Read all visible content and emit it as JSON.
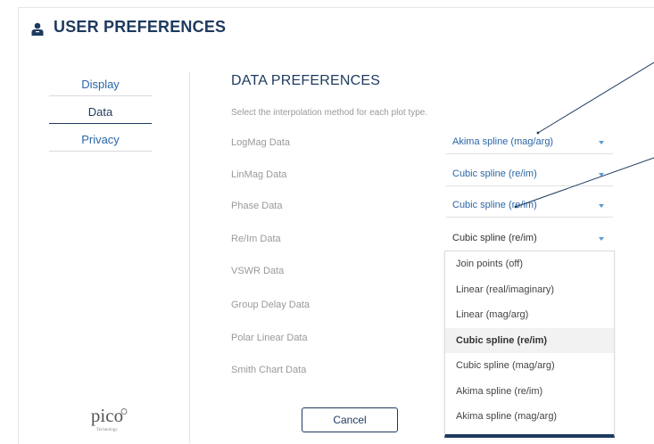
{
  "header": {
    "title": "USER PREFERENCES",
    "icon": "user-icon"
  },
  "sidebar": {
    "items": [
      {
        "label": "Display",
        "active": false
      },
      {
        "label": "Data",
        "active": true
      },
      {
        "label": "Privacy",
        "active": false
      }
    ]
  },
  "main": {
    "section_title": "DATA PREFERENCES",
    "instruction": "Select the interpolation method for each plot type.",
    "rows": [
      {
        "label": "LogMag Data",
        "value": "Akima spline (mag/arg)"
      },
      {
        "label": "LinMag Data",
        "value": "Cubic spline (re/im)"
      },
      {
        "label": "Phase Data",
        "value": "Cubic spline (re/im)"
      },
      {
        "label": "Re/Im Data",
        "value": "Cubic spline (re/im)",
        "open": true
      },
      {
        "label": "VSWR Data"
      },
      {
        "label": "Group Delay Data"
      },
      {
        "label": "Polar Linear Data"
      },
      {
        "label": "Smith Chart Data"
      }
    ],
    "dropdown": {
      "options": [
        "Join points (off)",
        "Linear (real/imaginary)",
        "Linear (mag/arg)",
        "Cubic spline (re/im)",
        "Cubic spline (mag/arg)",
        "Akima spline (re/im)",
        "Akima spline (mag/arg)"
      ],
      "selected": "Cubic spline (re/im)"
    }
  },
  "footer": {
    "cancel_label": "Cancel",
    "logo_text": "pico",
    "logo_subtext": "Technology"
  },
  "colors": {
    "accent": "#2b66a6",
    "navy": "#1e3a5f",
    "muted": "#9a9a9a"
  }
}
